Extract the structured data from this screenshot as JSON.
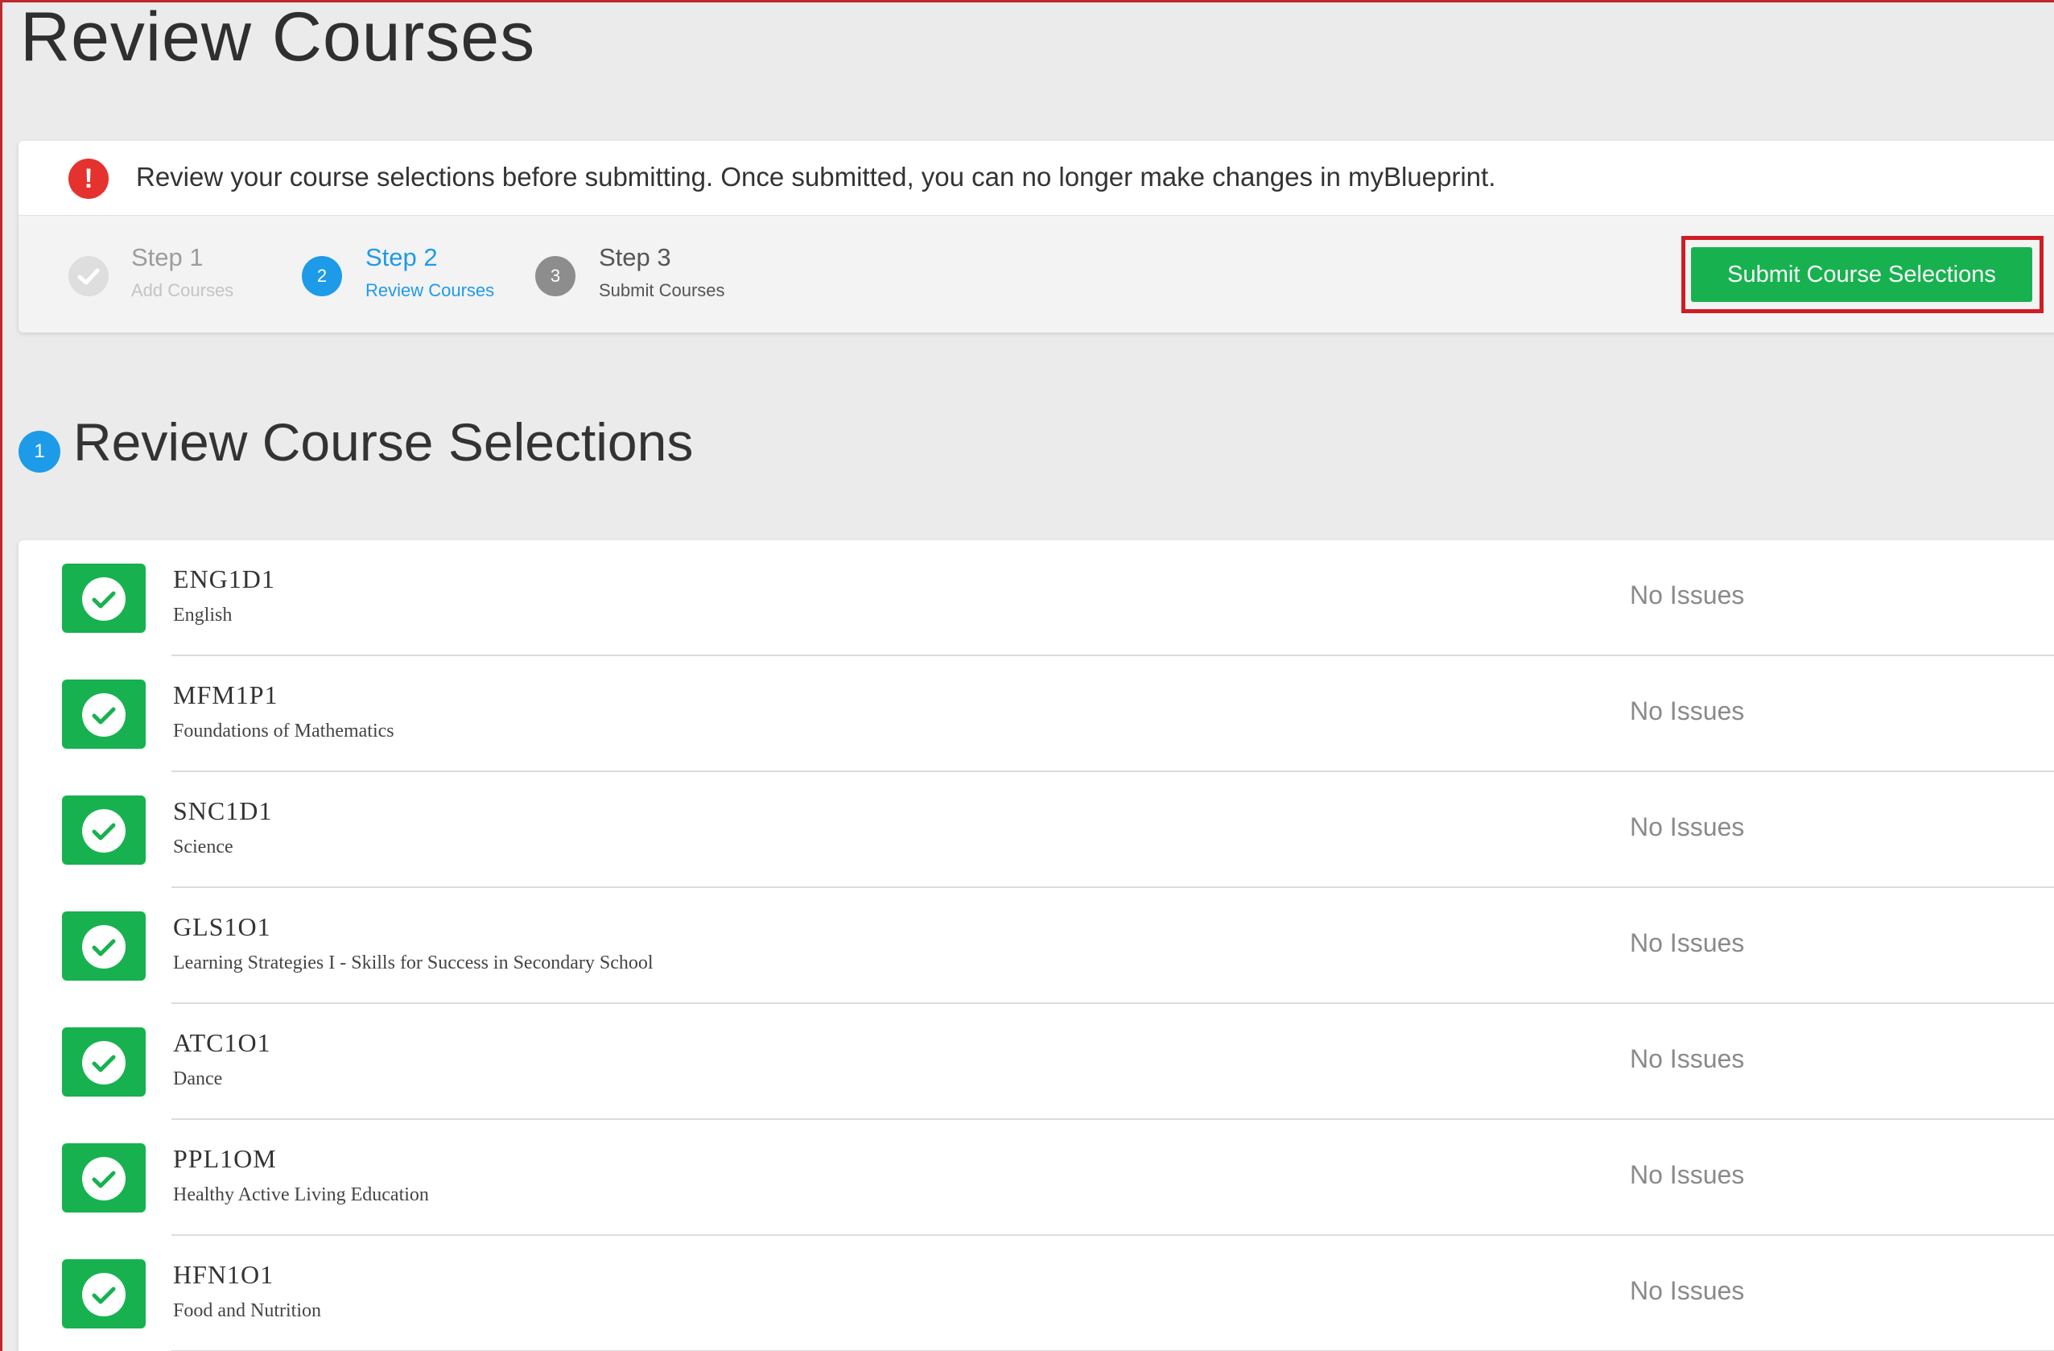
{
  "page": {
    "title": "Review Courses"
  },
  "alert": {
    "icon": "exclamation-icon",
    "icon_glyph": "!",
    "message": "Review your course selections before submitting. Once submitted, you can no longer make changes in myBlueprint.",
    "icon_color": "#e5322f"
  },
  "steps": [
    {
      "number": "",
      "title": "Step 1",
      "subtitle": "Add Courses",
      "state": "complete"
    },
    {
      "number": "2",
      "title": "Step 2",
      "subtitle": "Review Courses",
      "state": "current"
    },
    {
      "number": "3",
      "title": "Step 3",
      "subtitle": "Submit Courses",
      "state": "upcoming"
    }
  ],
  "submit_button": {
    "label": "Submit Course Selections",
    "color": "#17b24f",
    "highlight_color": "#d11c24"
  },
  "section": {
    "number": "1",
    "title": "Review Course Selections",
    "accent": "#1e9be8"
  },
  "courses": [
    {
      "code": "ENG1D1",
      "name": "English",
      "status": "No Issues"
    },
    {
      "code": "MFM1P1",
      "name": "Foundations of Mathematics",
      "status": "No Issues"
    },
    {
      "code": "SNC1D1",
      "name": "Science",
      "status": "No Issues"
    },
    {
      "code": "GLS1O1",
      "name": "Learning Strategies I - Skills for Success in Secondary School",
      "status": "No Issues"
    },
    {
      "code": "ATC1O1",
      "name": "Dance",
      "status": "No Issues"
    },
    {
      "code": "PPL1OM",
      "name": "Healthy Active Living Education",
      "status": "No Issues"
    },
    {
      "code": "HFN1O1",
      "name": "Food and Nutrition",
      "status": "No Issues"
    }
  ]
}
